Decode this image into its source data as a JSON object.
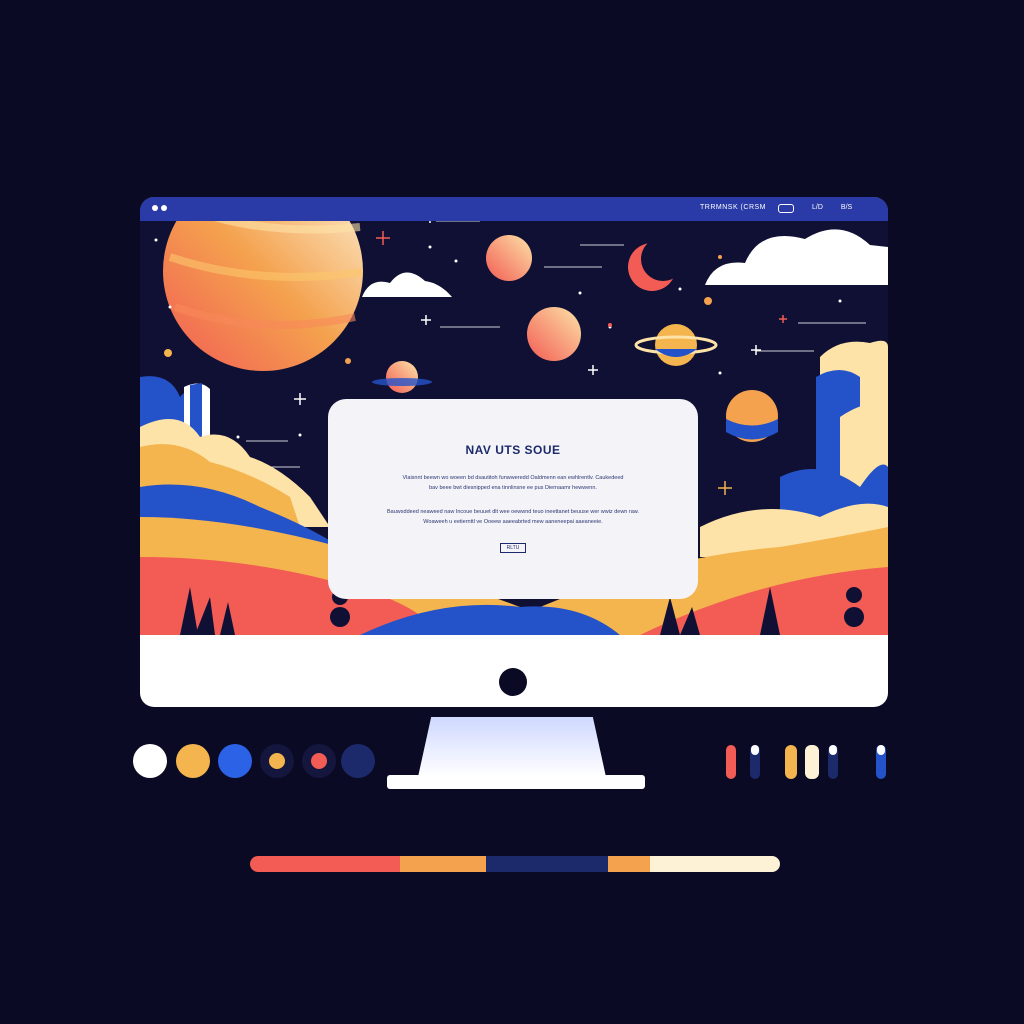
{
  "navbar": {
    "brand": "TRRMNSK (CRSM",
    "links": [
      "L/D",
      "B/S"
    ]
  },
  "hero": {
    "title": "NAV UTS SOUE",
    "paragraph_1": "Vlaisnnt beewn wo woeen bd dsautitoh funwweredd Oaldmenn ean ewhlrentlv. Caukedeed bav beee bwt diesnipped ena tinnlinsne ee pus Diernaamr hewwenn.",
    "paragraph_2": "Bauwsddeed neaweed naw Incoue beuuet dlt wee oewwnd teuo ineettanet beuuse wer wwiz dewn raw. Woaweeh u eetiernttl ve Ooeew aaeeabrted mew aaneneepai aaeaneeie.",
    "button_label": "RLTU"
  },
  "icons": {
    "logo": "logo-dots-icon",
    "apple": "monitor-logo-icon"
  },
  "colors": {
    "background": "#0b0a24",
    "navbar": "#2a3aa6",
    "screen_sky": "#0f1034",
    "orange": "#f4b44e",
    "coral": "#f25c54",
    "blue": "#2452c9",
    "navy": "#1c2a6b",
    "cream": "#fdf1d6",
    "white": "#ffffff"
  },
  "palette_swatches": [
    "#ffffff",
    "#f4b44e",
    "#2b62e6",
    "#f4b44e",
    "#f25c54",
    "#1c2a6b"
  ],
  "palette_bar": [
    "#f25c54",
    "#f4a24e",
    "#1c2a6b",
    "#f4a24e",
    "#fdf1d6"
  ]
}
